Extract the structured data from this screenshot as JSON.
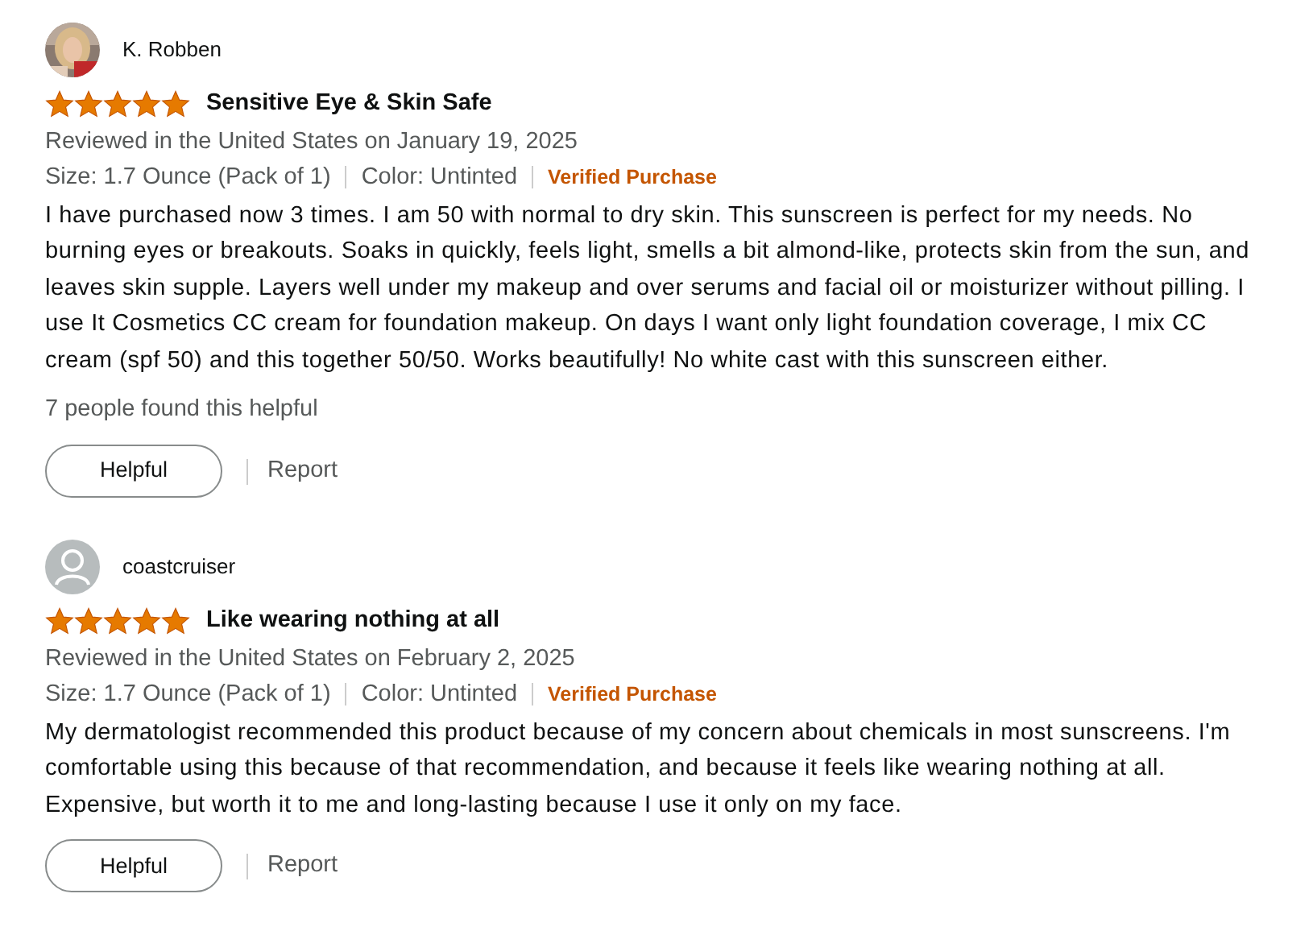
{
  "reviews": [
    {
      "author": "K. Robben",
      "stars": 5,
      "title": "Sensitive Eye & Skin Safe",
      "reviewed": "Reviewed in the United States on January 19, 2025",
      "size": "Size: 1.7 Ounce (Pack of 1)",
      "color_option": "Color: Untinted",
      "verified": "Verified Purchase",
      "body": "I have purchased now 3 times. I am 50 with normal to dry skin. This sunscreen is perfect for my needs. No burning eyes or breakouts. Soaks in quickly, feels light, smells a bit almond-like, protects skin from the sun, and leaves skin supple. Layers well under my makeup and over serums and facial oil or moisturizer without pilling. I use It Cosmetics CC cream for foundation makeup. On days I want only light foundation coverage, I mix CC cream (spf 50) and this together 50/50. Works beautifully! No white cast with this sunscreen either.",
      "helpful_count": "7 people found this helpful",
      "helpful_button": "Helpful",
      "report": "Report"
    },
    {
      "avatar": {
        "kind": "default"
      },
      "author": "coastcruiser",
      "stars": 5,
      "title": "Like wearing nothing at all",
      "reviewed": "Reviewed in the United States on February 2, 2025",
      "size": "Size: 1.7 Ounce (Pack of 1)",
      "color_option": "Color: Untinted",
      "verified": "Verified Purchase",
      "body": "My dermatologist recommended this product because of my concern about chemicals in most sunscreens. I'm comfortable using this because of that recommendation, and because it feels like wearing nothing at all. Expensive, but worth it to me and long-lasting because I use it only on my face.",
      "helpful_button": "Helpful",
      "report": "Report"
    }
  ]
}
